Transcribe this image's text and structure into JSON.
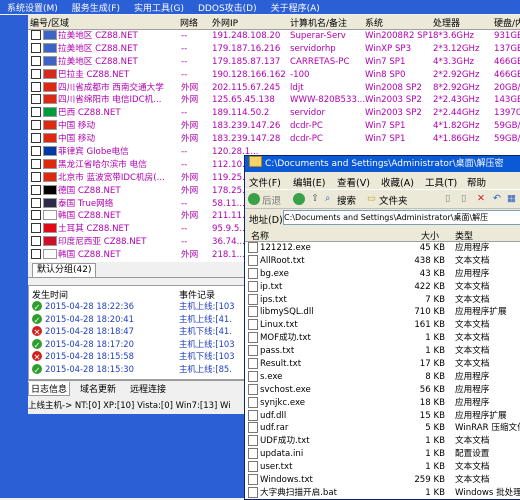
{
  "menu": [
    "系统设置(M)",
    "服务生成(F)",
    "实用工具(G)",
    "DDOS攻击(D)",
    "关于程序(A)"
  ],
  "columns": [
    "编号/区域",
    "网络",
    "外网IP",
    "计算机名/备注",
    "系统",
    "处理器",
    "硬盘/内存"
  ],
  "rows": [
    {
      "region": "拉美地区  CZ88.NET",
      "net": "--",
      "ip": "191.248.108.20",
      "name": "Superar-Serv",
      "os": "Win2008R2 SP1",
      "cpu": "8*3.6GHz",
      "disk": "931GB/",
      "flag": "#3b63c8"
    },
    {
      "region": "拉美地区  CZ88.NET",
      "net": "--",
      "ip": "179.187.16.216",
      "name": "servidorhp",
      "os": "WinXP SP3",
      "cpu": "2*3.12GHz",
      "disk": "137GB/",
      "flag": "#3b63c8"
    },
    {
      "region": "拉美地区  CZ88.NET",
      "net": "--",
      "ip": "179.185.87.137",
      "name": "CARRETAS-PC",
      "os": "Win7 SP1",
      "cpu": "4*3.3GHz",
      "disk": "466GB/",
      "flag": "#3b63c8"
    },
    {
      "region": "巴拉圭  CZ88.NET",
      "net": "--",
      "ip": "190.128.166.162",
      "name": "-100",
      "os": "Win8 SP0",
      "cpu": "2*2.92GHz",
      "disk": "466GB/",
      "flag": "#d52b1e"
    },
    {
      "region": "四川省成都市 西南交通大学",
      "net": "外网",
      "ip": "202.115.67.245",
      "name": "ldjt",
      "os": "Win2008 SP2",
      "cpu": "8*2.92GHz",
      "disk": "20GB/1",
      "flag": "#de2910"
    },
    {
      "region": "四川省绵阳市 电信IDC机...",
      "net": "外网",
      "ip": "125.65.45.138",
      "name": "WWW-820B533...",
      "os": "Win2003 SP2",
      "cpu": "2*2.43GHz",
      "disk": "143GB/",
      "flag": "#de2910"
    },
    {
      "region": "巴西  CZ88.NET",
      "net": "--",
      "ip": "189.114.50.2",
      "name": "servidor",
      "os": "Win2003 SP2",
      "cpu": "2*2.44GHz",
      "disk": "1397GB",
      "flag": "#009c3b"
    },
    {
      "region": "中国 移动",
      "net": "外网",
      "ip": "183.239.147.26",
      "name": "dcdr-PC",
      "os": "Win7 SP1",
      "cpu": "4*1.82GHz",
      "disk": "59GB/1",
      "flag": "#de2910"
    },
    {
      "region": "中国 移动",
      "net": "外网",
      "ip": "183.239.147.28",
      "name": "dcdr-PC",
      "os": "Win7 SP1",
      "cpu": "4*1.86GHz",
      "disk": "59GB/1",
      "flag": "#de2910"
    },
    {
      "region": "菲律宾 Globe电信",
      "net": "--",
      "ip": "120.28.1...",
      "name": "",
      "os": "",
      "cpu": "",
      "disk": "",
      "flag": "#0038a8"
    },
    {
      "region": "黑龙江省哈尔滨市 电信",
      "net": "--",
      "ip": "112.10...",
      "name": "",
      "os": "",
      "cpu": "",
      "disk": "",
      "flag": "#de2910"
    },
    {
      "region": "北京市 蓝波宽带IDC机房(...",
      "net": "外网",
      "ip": "119.25...",
      "name": "",
      "os": "",
      "cpu": "",
      "disk": "",
      "flag": "#de2910"
    },
    {
      "region": "德国  CZ88.NET",
      "net": "外网",
      "ip": "178.25...",
      "name": "",
      "os": "",
      "cpu": "",
      "disk": "",
      "flag": "#000000"
    },
    {
      "region": "泰国 True网络",
      "net": "--",
      "ip": "58.11...",
      "name": "",
      "os": "",
      "cpu": "",
      "disk": "",
      "flag": "#2d2a4a"
    },
    {
      "region": "韩国  CZ88.NET",
      "net": "外网",
      "ip": "211.11...",
      "name": "",
      "os": "",
      "cpu": "",
      "disk": "",
      "flag": "#ffffff"
    },
    {
      "region": "土耳其  CZ88.NET",
      "net": "--",
      "ip": "95.9.5...",
      "name": "",
      "os": "",
      "cpu": "",
      "disk": "",
      "flag": "#e30a17"
    },
    {
      "region": "印度尼西亚  CZ88.NET",
      "net": "--",
      "ip": "36.74...",
      "name": "",
      "os": "",
      "cpu": "",
      "disk": "",
      "flag": "#ce1126"
    },
    {
      "region": "韩国  CZ88.NET",
      "net": "外网",
      "ip": "218.1...",
      "name": "",
      "os": "",
      "cpu": "",
      "disk": "",
      "flag": "#ffffff"
    }
  ],
  "group_tab": "默认分组(42)",
  "log": {
    "header_time": "发生时间",
    "header_event": "事件记录",
    "entries": [
      {
        "time": "2015-04-28 18:22:36",
        "event": "主机上线:[103",
        "ok": true
      },
      {
        "time": "2015-04-28 18:20:41",
        "event": "主机上线:[41.",
        "ok": true
      },
      {
        "time": "2015-04-28 18:18:47",
        "event": "主机下线:[41.",
        "ok": false
      },
      {
        "time": "2015-04-28 18:17:20",
        "event": "主机上线:[103",
        "ok": true
      },
      {
        "time": "2015-04-28 18:15:58",
        "event": "主机下线:[103",
        "ok": false
      },
      {
        "time": "2015-04-28 18:15:30",
        "event": "主机上线:[85.",
        "ok": true
      }
    ]
  },
  "bottom_tabs": [
    "日志信息",
    "域名更新",
    "远程连接"
  ],
  "statusbar": "上线主机-> NT:[0] XP:[10] Vista:[0] Win7:[13] Wi",
  "explorer": {
    "title": "C:\\Documents and Settings\\Administrator\\桌面\\解压密",
    "menu": [
      "文件(F)",
      "编辑(E)",
      "查看(V)",
      "收藏(A)",
      "工具(T)",
      "帮助"
    ],
    "toolbar": {
      "back": "后退",
      "search": "搜索",
      "folders": "文件夹"
    },
    "address_label": "地址(D)",
    "address": "C:\\Documents and Settings\\Administrator\\桌面\\解压",
    "col_name": "名称",
    "col_size": "大小",
    "col_type": "类型",
    "files": [
      {
        "name": "121212.exe",
        "size": "45 KB",
        "type": "应用程序"
      },
      {
        "name": "AllRoot.txt",
        "size": "438 KB",
        "type": "文本文档"
      },
      {
        "name": "bg.exe",
        "size": "43 KB",
        "type": "应用程序"
      },
      {
        "name": "ip.txt",
        "size": "422 KB",
        "type": "文本文档"
      },
      {
        "name": "ips.txt",
        "size": "7 KB",
        "type": "文本文档"
      },
      {
        "name": "libmySQL.dll",
        "size": "710 KB",
        "type": "应用程序扩展"
      },
      {
        "name": "Linux.txt",
        "size": "161 KB",
        "type": "文本文档"
      },
      {
        "name": "MOF成功.txt",
        "size": "1 KB",
        "type": "文本文档"
      },
      {
        "name": "pass.txt",
        "size": "1 KB",
        "type": "文本文档"
      },
      {
        "name": "Result.txt",
        "size": "17 KB",
        "type": "文本文档"
      },
      {
        "name": "s.exe",
        "size": "8 KB",
        "type": "应用程序"
      },
      {
        "name": "svchost.exe",
        "size": "56 KB",
        "type": "应用程序"
      },
      {
        "name": "synjkc.exe",
        "size": "18 KB",
        "type": "应用程序"
      },
      {
        "name": "udf.dll",
        "size": "15 KB",
        "type": "应用程序扩展"
      },
      {
        "name": "udf.rar",
        "size": "5 KB",
        "type": "WinRAR 压缩文件"
      },
      {
        "name": "UDF成功.txt",
        "size": "1 KB",
        "type": "文本文档"
      },
      {
        "name": "updata.ini",
        "size": "1 KB",
        "type": "配置设置"
      },
      {
        "name": "user.txt",
        "size": "1 KB",
        "type": "文本文档"
      },
      {
        "name": "Windows.txt",
        "size": "259 KB",
        "type": "文本文档"
      },
      {
        "name": "大字典扫描开启.bat",
        "size": "1 KB",
        "type": "Windows 批处理"
      }
    ]
  }
}
